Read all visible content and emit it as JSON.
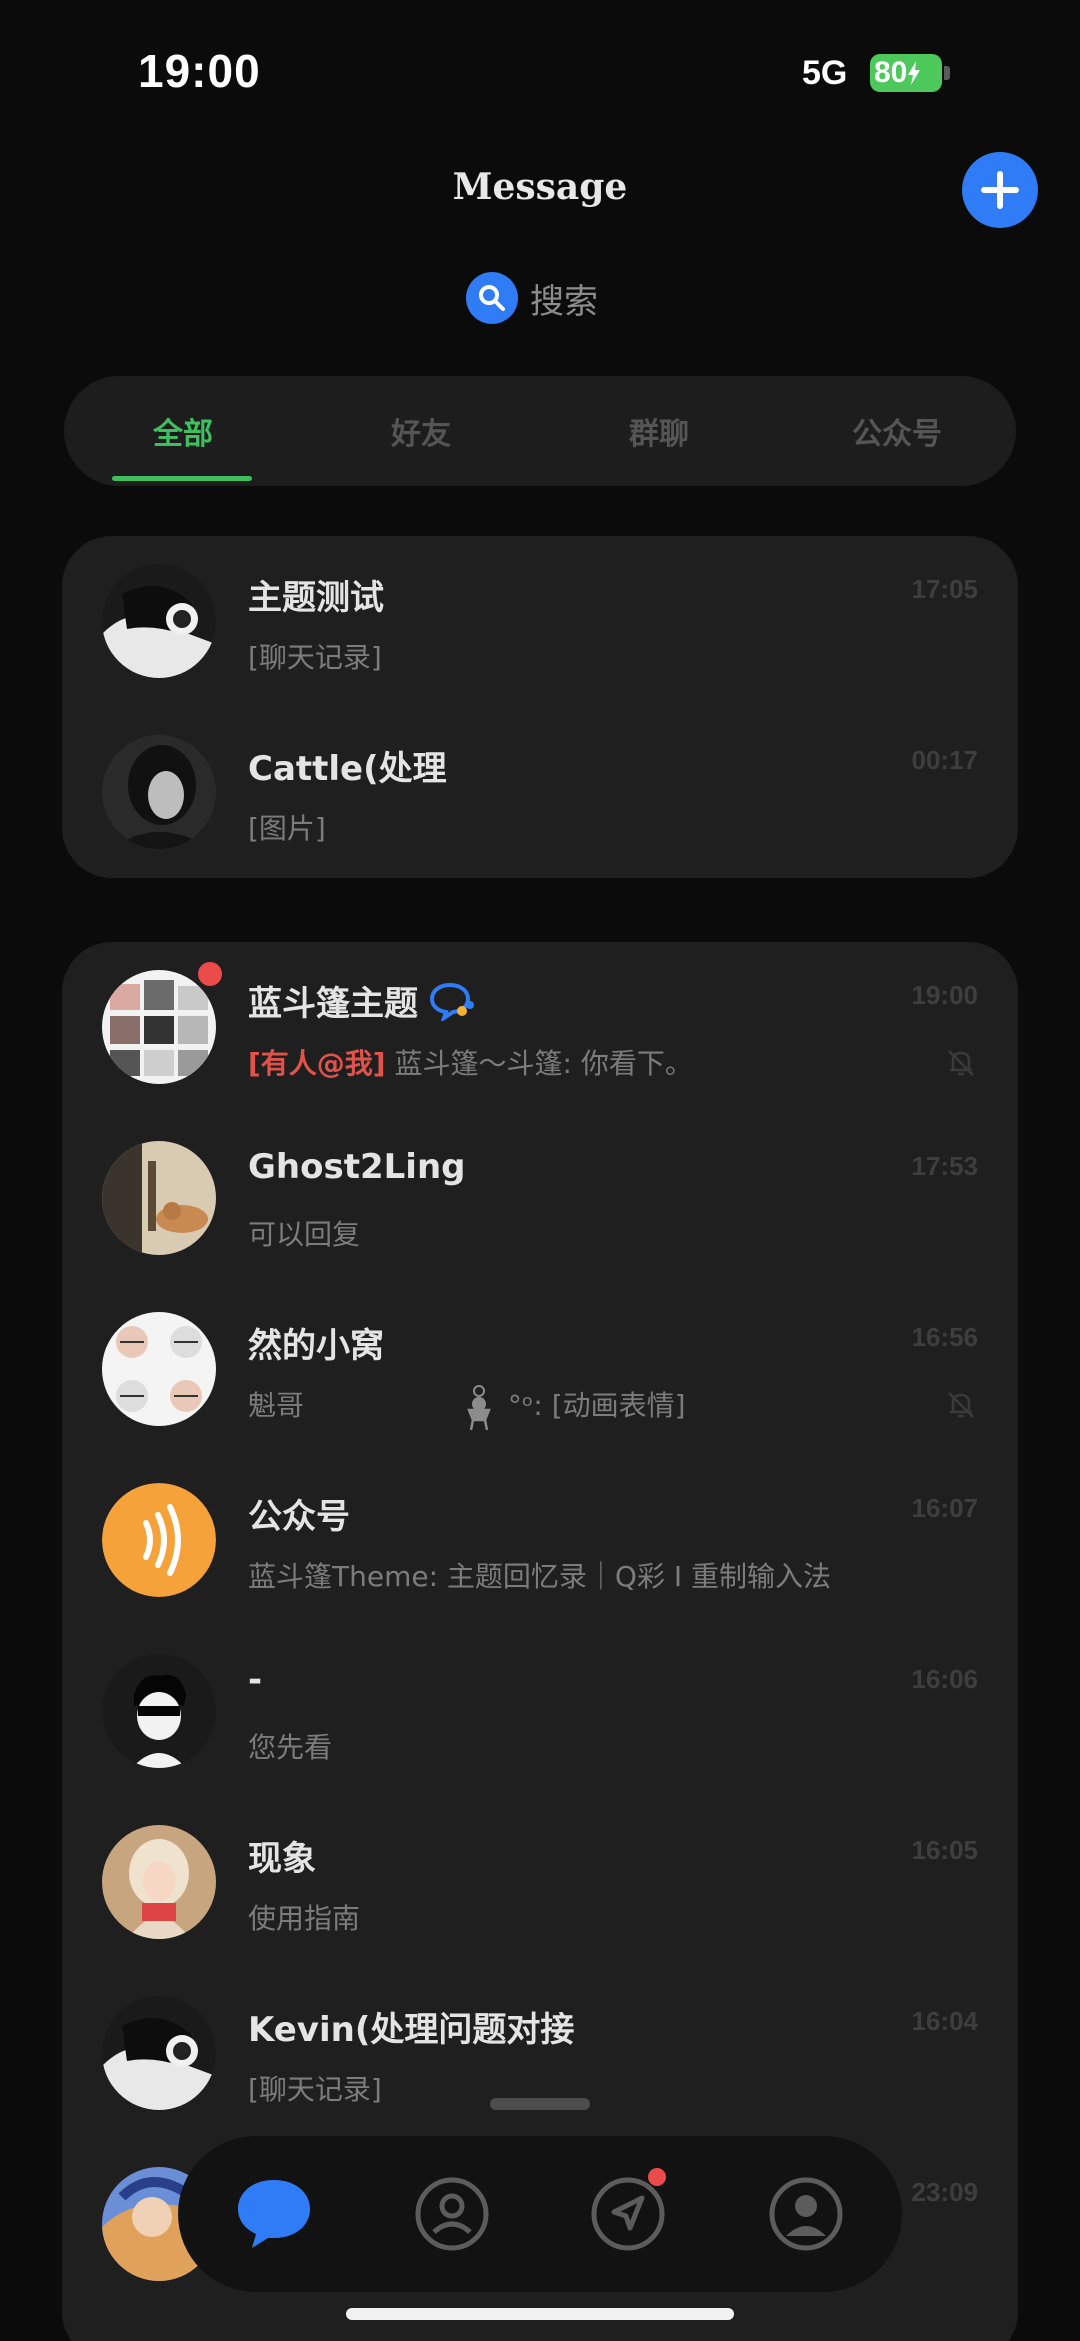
{
  "status_bar": {
    "time": "19:00",
    "network": "5G",
    "battery": "80"
  },
  "header": {
    "title": "Message",
    "search_label": "搜索"
  },
  "tabs": [
    {
      "label": "全部",
      "active": true
    },
    {
      "label": "好友",
      "active": false
    },
    {
      "label": "群聊",
      "active": false
    },
    {
      "label": "公众号",
      "active": false
    }
  ],
  "pinned": [
    {
      "name": "主题测试",
      "preview": "[聊天记录]",
      "time": "17:05"
    },
    {
      "name": "Cattle(处理",
      "preview": "[图片]",
      "time": "00:17"
    }
  ],
  "chats": [
    {
      "name": "蓝斗篷主题",
      "mention": "[有人@我]",
      "preview": "蓝斗篷～斗篷: 你看下。",
      "time": "19:00",
      "muted": true,
      "unread": true
    },
    {
      "name": "Ghost2Ling",
      "preview": "可以回复",
      "time": "17:53"
    },
    {
      "name": "然的小窝",
      "preview": "魁哥",
      "preview_tail": "°ᵒ: [动画表情]",
      "time": "16:56",
      "muted": true
    },
    {
      "name": "公众号",
      "preview": "蓝斗篷Theme: 主题回忆录｜Q彩 I 重制输入法",
      "time": "16:07"
    },
    {
      "name": "-",
      "preview": "您先看",
      "time": "16:06"
    },
    {
      "name": "现象",
      "preview": "使用指南",
      "time": "16:05"
    },
    {
      "name": "Kevin(处理问题对接",
      "preview": "[聊天记录]",
      "time": "16:04"
    },
    {
      "name": "",
      "preview": "",
      "time": "23:09"
    }
  ],
  "colors": {
    "accent": "#2f7cf6",
    "active_tab": "#3fbf5f",
    "mention": "#e0524a",
    "badge": "#ec4b4b",
    "battery": "#4cc95a"
  }
}
